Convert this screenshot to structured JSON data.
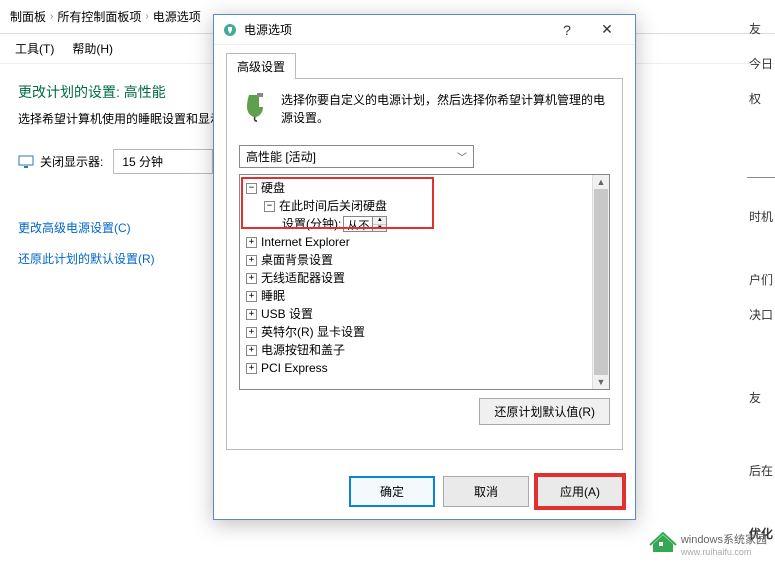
{
  "bg": {
    "breadcrumb": {
      "item1": "制面板",
      "item2": "所有控制面板项",
      "item3": "电源选项"
    },
    "menubar": {
      "tools": "工具(T)",
      "help": "帮助(H)"
    },
    "heading": "更改计划的设置: 高性能",
    "subtext": "选择希望计算机使用的睡眠设置和显示",
    "display_off_label": "关闭显示器:",
    "display_off_value": "15 分钟",
    "link_advanced": "更改高级电源设置(C)",
    "link_restore": "还原此计划的默认设置(R)"
  },
  "right": {
    "t1": "友",
    "t2": "今日",
    "t3": "权",
    "t4": "时机",
    "t5": "户们",
    "t6": "决口",
    "t7": "友",
    "t8": "后在",
    "t9": "优化"
  },
  "dialog": {
    "title": "电源选项",
    "tab": "高级设置",
    "description": "选择你要自定义的电源计划，然后选择你希望计算机管理的电源设置。",
    "plan": "高性能 [活动]",
    "tree": {
      "n0": "硬盘",
      "n1": "在此时间后关闭硬盘",
      "n2_label": "设置(分钟):",
      "n2_value": "从不",
      "n3": "Internet Explorer",
      "n4": "桌面背景设置",
      "n5": "无线适配器设置",
      "n6": "睡眠",
      "n7": "USB 设置",
      "n8": "英特尔(R) 显卡设置",
      "n9": "电源按钮和盖子",
      "n10": "PCI Express"
    },
    "restore_btn": "还原计划默认值(R)",
    "ok": "确定",
    "cancel": "取消",
    "apply": "应用(A)"
  },
  "watermark": {
    "name": "windows系统家园",
    "url": "www.ruihaifu.com"
  }
}
